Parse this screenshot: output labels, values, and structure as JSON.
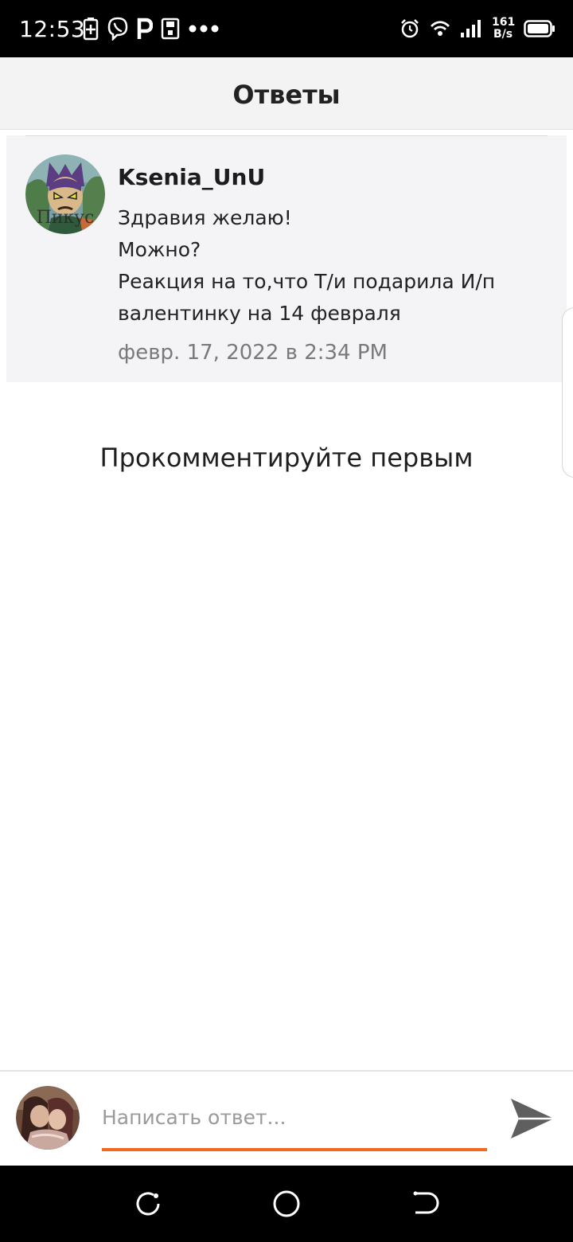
{
  "status_bar": {
    "time": "12:53",
    "net_speed_value": "161",
    "net_speed_unit": "B/s",
    "left_icons": [
      "battery-saver-icon",
      "viber-icon",
      "parking-icon",
      "sim-save-icon",
      "more-dots-icon"
    ],
    "right_icons": [
      "alarm-icon",
      "wifi-icon",
      "signal-icon",
      "battery-icon"
    ]
  },
  "header": {
    "title": "Ответы"
  },
  "post": {
    "author": "Ksenia_UnU",
    "avatar_caption": "Пикус",
    "text_lines": [
      "Здравия желаю!",
      "Можно?",
      "Реакция на то,что Т/и подарила И/п",
      "валентинку на 14 февраля"
    ],
    "date": "февр. 17, 2022 в 2:34 PM"
  },
  "comments": {
    "empty_message": "Прокомментируйте первым"
  },
  "reply": {
    "placeholder": "Написать ответ...",
    "value": "",
    "send_icon": "send-icon"
  },
  "nav_bar": {
    "buttons": [
      "back-icon",
      "home-icon",
      "recents-icon"
    ]
  },
  "colors": {
    "accent": "#f26a21",
    "header_bg": "#f3f3f3",
    "post_bg": "#f4f3f6"
  }
}
